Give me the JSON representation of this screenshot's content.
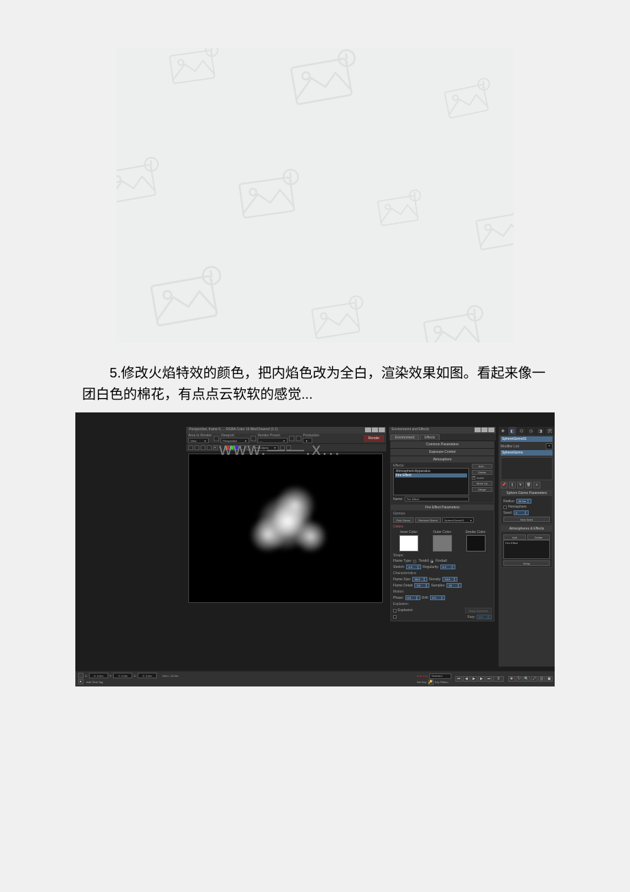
{
  "placeholder_icon": "image-warning-icon",
  "body_text": "5.修改火焰特效的颜色，把内焰色改为全白，渲染效果如图。看起来像一团白色的棉花，有点点云软软的感觉...",
  "watermark": "www.——.x...",
  "render_window": {
    "title": "Perspective, frame 0, ... RGBA Color 16 Bits/Channel (1:1)",
    "area_label": "Area to Render:",
    "area_value": "View",
    "viewport_label": "Viewport:",
    "viewport_value": "Perspective",
    "preset_label": "Render Preset:",
    "production_label": "Production",
    "render_btn": "Render",
    "rgb_alpha": "RGB Alpha"
  },
  "env_window": {
    "title": "Environment and Effects",
    "tabs": [
      "Environment",
      "Effects"
    ],
    "rollouts": {
      "common": "Common Parameters",
      "exposure": "Exposure Control",
      "atmosphere": "Atmosphere"
    },
    "effects_label": "Effects:",
    "effects": [
      "AtmosphericApparatus",
      "Fire Effect"
    ],
    "buttons": {
      "add": "Add...",
      "delete": "Delete",
      "active": "Active",
      "moveup": "Move Up",
      "merge": "Merge"
    },
    "name_label": "Name:",
    "name_value": "Fire Effect",
    "fire_rollout": "Fire Effect Parameters",
    "gizmos_label": "Gizmos:",
    "pick_gizmo": "Pick Gizmo",
    "remove_gizmo": "Remove Gizmo",
    "gizmo_selected": "SphereGizmo01",
    "colors_label": "Colors:",
    "inner_color": "Inner Color:",
    "outer_color": "Outer Color:",
    "smoke_color": "Smoke Color:",
    "shape_label": "Shape:",
    "flame_type_label": "Flame Type:",
    "tendril": "Tendril",
    "fireball": "Fireball",
    "stretch_label": "Stretch:",
    "stretch_val": "1.0",
    "regularity_label": "Regularity:",
    "regularity_val": "0.2",
    "char_label": "Characteristics:",
    "flame_size_label": "Flame Size:",
    "flame_size_val": "35.0",
    "density_label": "Density:",
    "density_val": "15.0",
    "flame_detail_label": "Flame Detail:",
    "flame_detail_val": "3.0",
    "samples_label": "Samples:",
    "samples_val": "15",
    "motion_label": "Motion:",
    "phase_label": "Phase:",
    "phase_val": "0.0",
    "drift_label": "Drift:",
    "drift_val": "0.0",
    "explosion_label": "Explosion:",
    "explosion_chk": "Explosion",
    "explosion_setup": "Setup Explosion",
    "fury_label": "Fury:"
  },
  "cmd_panel": {
    "object_name": "SphereGizmo01",
    "modlist_label": "Modifier List",
    "stack_item": "SphereGizmo",
    "gizmo_rollout": "Sphere Gizmo Parameters",
    "radius_label": "Radius:",
    "radius_val": "20.0m",
    "hemisphere": "Hemisphere",
    "seed_label": "Seed:",
    "seed_val": "0",
    "newseed": "New Seed",
    "atmos_rollout": "Atmospheres & Effects",
    "add_btn": "Add",
    "delete_btn": "Delete",
    "fx_item": "Fire Effect",
    "setup_btn": "Setup"
  },
  "statusbar": {
    "x": "X: 0.0m",
    "y": "Y: 0.0m",
    "z": "Z: 0.0m",
    "grid": "Grid = 10.0m",
    "addtimetag": "Add Time Tag",
    "autokey": "Auto Key",
    "selected": "Selected",
    "setkey": "Set Key",
    "keyfilters": "Key Filters...",
    "frame": "0"
  }
}
